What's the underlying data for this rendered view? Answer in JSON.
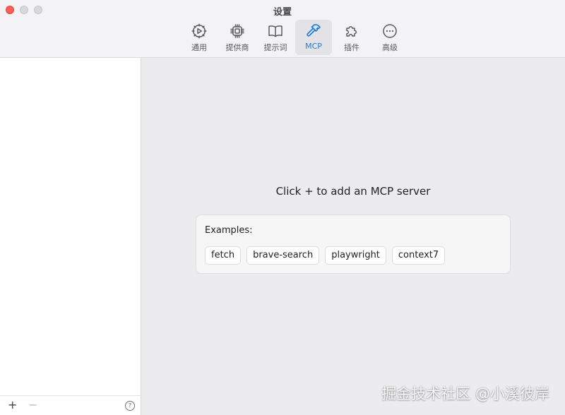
{
  "window": {
    "title": "设置"
  },
  "tabs": [
    {
      "label": "通用",
      "icon": "gear-icon"
    },
    {
      "label": "提供商",
      "icon": "chip-icon"
    },
    {
      "label": "提示词",
      "icon": "book-icon"
    },
    {
      "label": "MCP",
      "icon": "hammer-icon",
      "active": true
    },
    {
      "label": "插件",
      "icon": "puzzle-icon"
    },
    {
      "label": "高级",
      "icon": "ellipsis-icon"
    }
  ],
  "sidebar": {
    "add_label": "+",
    "remove_label": "−",
    "help_label": "?"
  },
  "main": {
    "hint": "Click + to add an MCP server",
    "examples_title": "Examples:",
    "examples": [
      "fetch",
      "brave-search",
      "playwright",
      "context7"
    ]
  },
  "watermark": "掘金技术社区 @小溪彼岸",
  "colors": {
    "accent": "#1f7bd8",
    "close": "#ff5f57"
  }
}
